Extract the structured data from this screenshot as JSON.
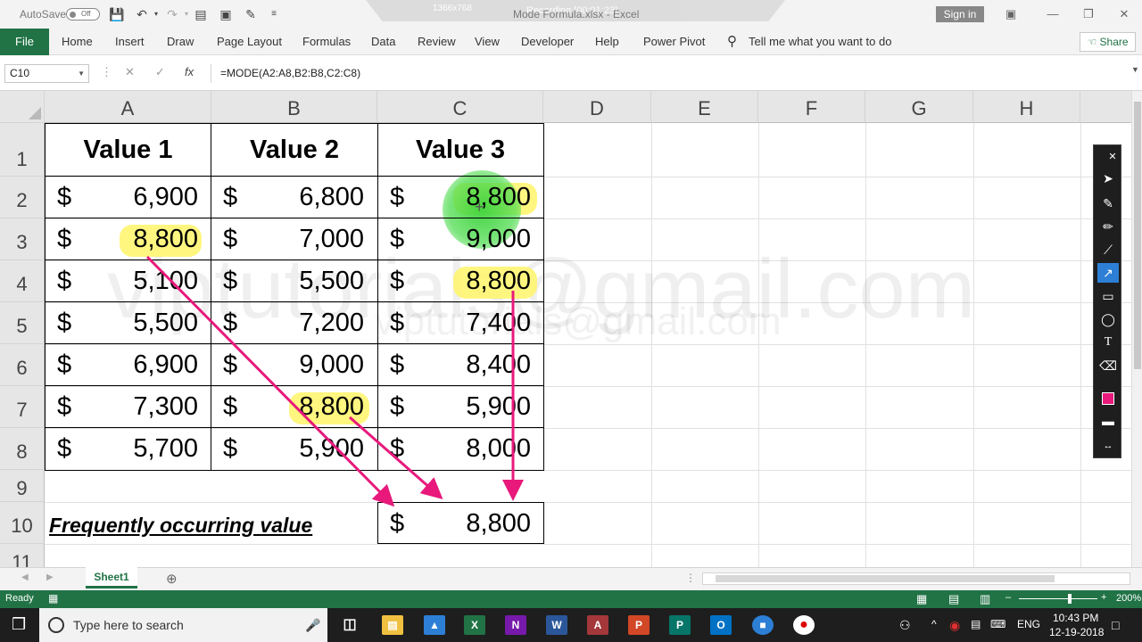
{
  "titlebar": {
    "autosave_label": "AutoSave",
    "autosave_state": "Off",
    "doc_title": "Mode Formula.xlsx - Excel",
    "recorder_resolution": "1366x768",
    "recorder_status": "Recording [00:01:23]",
    "signin_label": "Sign in"
  },
  "ribbon": {
    "file": "File",
    "tabs": [
      "Home",
      "Insert",
      "Draw",
      "Page Layout",
      "Formulas",
      "Data",
      "Review",
      "View",
      "Developer",
      "Help",
      "Power Pivot"
    ],
    "tell_me": "Tell me what you want to do",
    "share": "Share"
  },
  "formula_bar": {
    "name_box": "C10",
    "fx": "fx",
    "formula": "=MODE(A2:A8,B2:B8,C2:C8)"
  },
  "columns": [
    "A",
    "B",
    "C",
    "D",
    "E",
    "F",
    "G",
    "H"
  ],
  "rows": [
    "1",
    "2",
    "3",
    "4",
    "5",
    "6",
    "7",
    "8",
    "9",
    "10",
    "11"
  ],
  "table": {
    "headers": [
      "Value 1",
      "Value 2",
      "Value 3"
    ],
    "currency": "$",
    "values": [
      [
        "6,900",
        "6,800",
        "8,800"
      ],
      [
        "8,800",
        "7,000",
        "9,000"
      ],
      [
        "5,100",
        "5,500",
        "8,800"
      ],
      [
        "5,500",
        "7,200",
        "7,400"
      ],
      [
        "6,900",
        "9,000",
        "8,400"
      ],
      [
        "7,300",
        "8,800",
        "5,900"
      ],
      [
        "5,700",
        "5,900",
        "8,000"
      ]
    ]
  },
  "result": {
    "label": "Frequently occurring value",
    "currency": "$",
    "value": "8,800"
  },
  "watermark": {
    "large": "viptutorials@gmail.com",
    "small": "viptutorials@gmail.com"
  },
  "sheets": {
    "active": "Sheet1"
  },
  "status": {
    "ready": "Ready",
    "zoom": "200%"
  },
  "taskbar": {
    "search_placeholder": "Type here to search",
    "language": "ENG",
    "time": "10:43 PM",
    "date": "12-19-2018"
  },
  "colors": {
    "excel_green": "#217346",
    "highlight": "#fff46a",
    "arrow": "#e8197b"
  }
}
